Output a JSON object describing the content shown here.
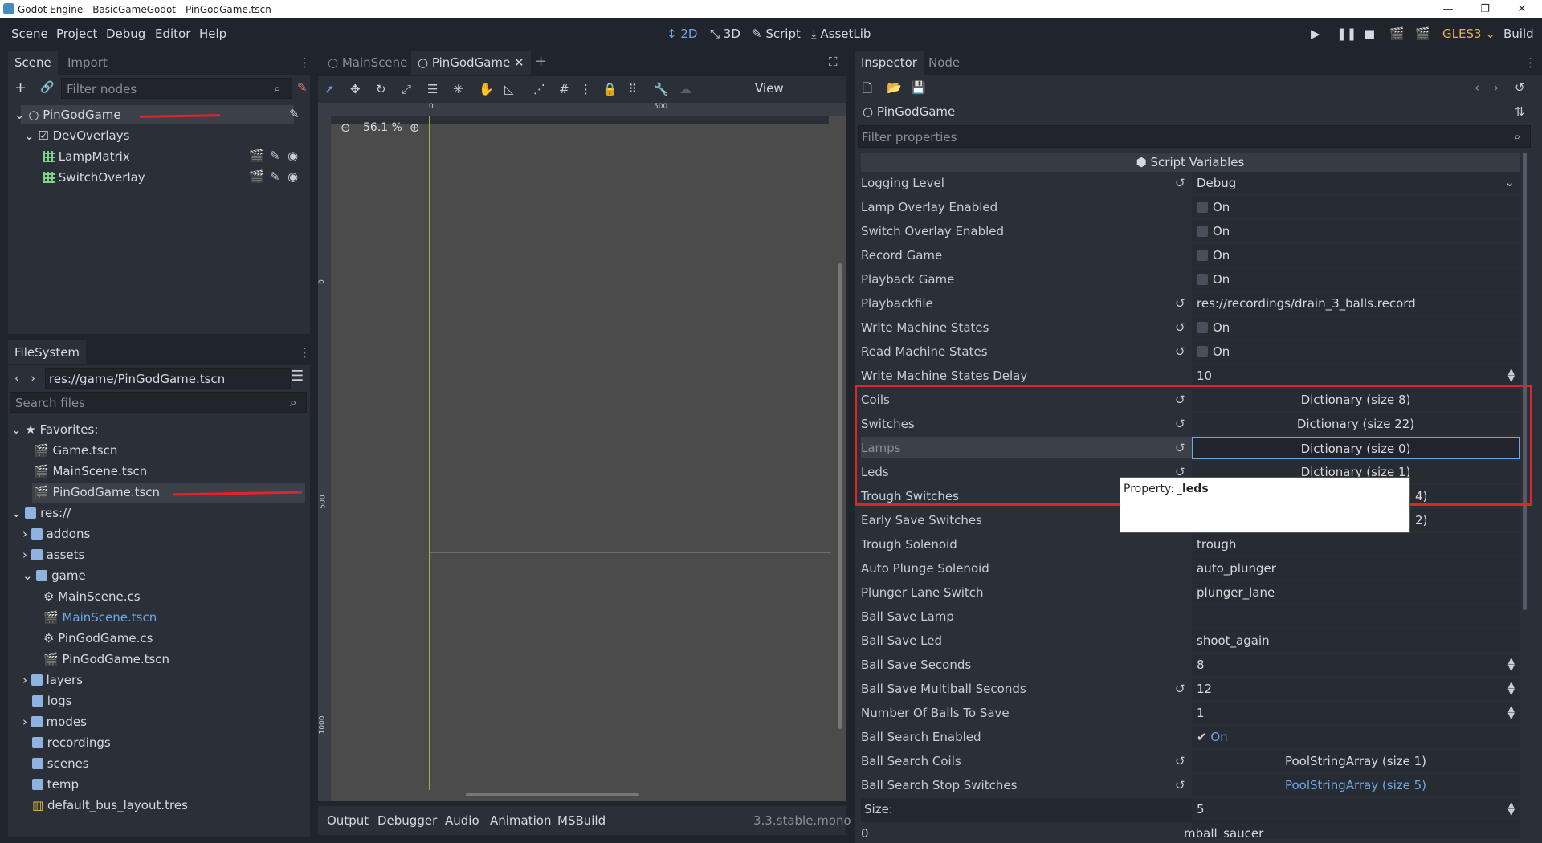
{
  "window": {
    "title": "Godot Engine - BasicGameGodot - PinGodGame.tscn",
    "controls": [
      "—",
      "❐",
      "✕"
    ]
  },
  "menu": [
    "Scene",
    "Project",
    "Debug",
    "Editor",
    "Help"
  ],
  "modes": {
    "m2d": "2D",
    "m3d": "3D",
    "script": "Script",
    "assetlib": "AssetLib"
  },
  "run": {
    "renderer": "GLES3",
    "build": "Build"
  },
  "scene_dock": {
    "tabs": [
      "Scene",
      "Import"
    ],
    "filter_placeholder": "Filter nodes",
    "nodes": [
      "PinGodGame",
      "DevOverlays",
      "LampMatrix",
      "SwitchOverlay"
    ]
  },
  "filesystem": {
    "tab": "FileSystem",
    "path": "res://game/PinGodGame.tscn",
    "search_placeholder": "Search files",
    "favorites_label": "Favorites:",
    "favorites": [
      "Game.tscn",
      "MainScene.tscn",
      "PinGodGame.tscn"
    ],
    "root": "res://",
    "items": {
      "addons": "addons",
      "assets": "assets",
      "game": "game",
      "mainscene_cs": "MainScene.cs",
      "mainscene_tscn": "MainScene.tscn",
      "pingod_cs": "PinGodGame.cs",
      "pingod_tscn": "PinGodGame.tscn",
      "layers": "layers",
      "logs": "logs",
      "modes": "modes",
      "recordings": "recordings",
      "scenes": "scenes",
      "temp": "temp",
      "bus": "default_bus_layout.tres"
    }
  },
  "editor": {
    "tabs": [
      "MainScene",
      "PinGodGame"
    ],
    "zoom": "56.1 %",
    "view_label": "View",
    "ruler": {
      "top_0": "0",
      "top_500": "500",
      "left_0": "0",
      "left_500": "500",
      "left_1000": "1000"
    }
  },
  "bottom": {
    "tabs": [
      "Output",
      "Debugger",
      "Audio",
      "Animation",
      "MSBuild"
    ],
    "version": "3.3.stable.mono"
  },
  "inspector": {
    "tabs": [
      "Inspector",
      "Node"
    ],
    "node_name": "PinGodGame",
    "filter_placeholder": "Filter properties",
    "section": "Script Variables",
    "props": {
      "logging_level": {
        "label": "Logging Level",
        "value": "Debug"
      },
      "lamp_overlay": {
        "label": "Lamp Overlay Enabled",
        "value": "On"
      },
      "switch_overlay": {
        "label": "Switch Overlay Enabled",
        "value": "On"
      },
      "record_game": {
        "label": "Record Game",
        "value": "On"
      },
      "playback_game": {
        "label": "Playback Game",
        "value": "On"
      },
      "playbackfile": {
        "label": "Playbackfile",
        "value": "res://recordings/drain_3_balls.record"
      },
      "write_states": {
        "label": "Write Machine States",
        "value": "On"
      },
      "read_states": {
        "label": "Read Machine States",
        "value": "On"
      },
      "write_delay": {
        "label": "Write Machine States Delay",
        "value": "10"
      },
      "coils": {
        "label": "Coils",
        "value": "Dictionary (size 8)"
      },
      "switches": {
        "label": "Switches",
        "value": "Dictionary (size 22)"
      },
      "lamps": {
        "label": "Lamps",
        "value": "Dictionary (size 0)"
      },
      "leds": {
        "label": "Leds",
        "value": "Dictionary (size 1)"
      },
      "trough_switches": {
        "label": "Trough Switches",
        "value": "4)"
      },
      "early_save": {
        "label": "Early Save Switches",
        "value": "2)"
      },
      "trough_solenoid": {
        "label": "Trough Solenoid",
        "value": "trough"
      },
      "auto_plunge": {
        "label": "Auto Plunge Solenoid",
        "value": "auto_plunger"
      },
      "plunger_lane": {
        "label": "Plunger Lane Switch",
        "value": "plunger_lane"
      },
      "ball_save_lamp": {
        "label": "Ball Save Lamp",
        "value": ""
      },
      "ball_save_led": {
        "label": "Ball Save Led",
        "value": "shoot_again"
      },
      "ball_save_seconds": {
        "label": "Ball Save Seconds",
        "value": "8"
      },
      "ball_save_multi": {
        "label": "Ball Save Multiball Seconds",
        "value": "12"
      },
      "num_balls": {
        "label": "Number Of Balls To Save",
        "value": "1"
      },
      "search_enabled": {
        "label": "Ball Search Enabled",
        "value": "On"
      },
      "search_coils": {
        "label": "Ball Search Coils",
        "value": "PoolStringArray (size 1)"
      },
      "search_stop": {
        "label": "Ball Search Stop Switches",
        "value": "PoolStringArray (size 5)"
      },
      "size": {
        "label": "Size:",
        "value": "5"
      },
      "item0": {
        "label": "0",
        "value": "mball_saucer"
      }
    },
    "tooltip": {
      "prefix": "Property:",
      "name": "_leds"
    }
  },
  "colors": {
    "accent": "#6fa6e8",
    "highlight": "#e0242b",
    "panel": "#2b2f37",
    "bg": "#20242b"
  }
}
